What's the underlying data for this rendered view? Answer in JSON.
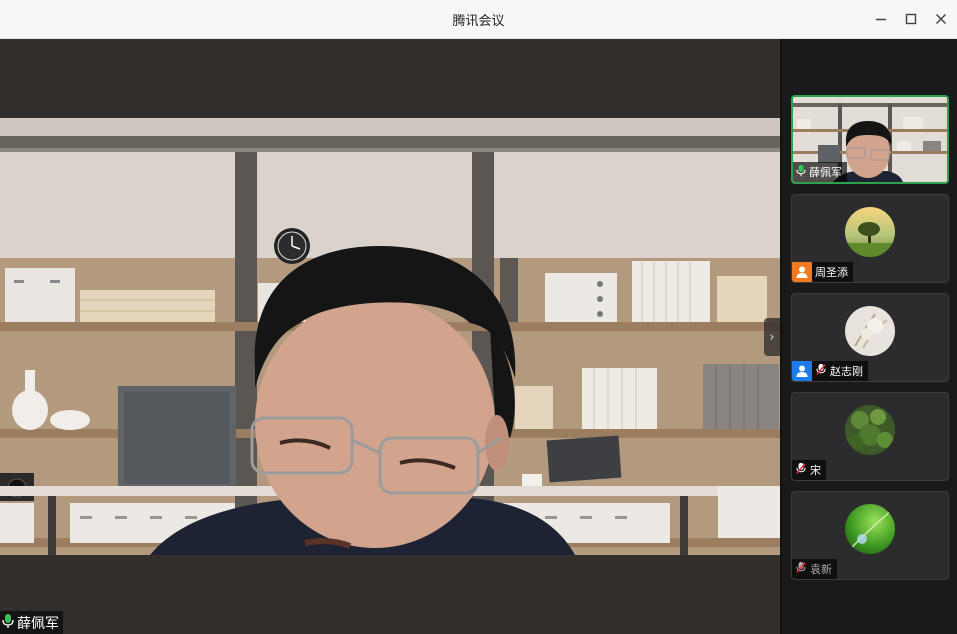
{
  "window": {
    "title": "腾讯会议",
    "minimize_icon": "minimize-icon",
    "maximize_icon": "maximize-icon",
    "close_icon": "close-icon"
  },
  "main_video": {
    "speaker_name": "薛佩军",
    "mic_state": "unmuted",
    "next_icon": "chevron-right-icon"
  },
  "participants": [
    {
      "name": "薛佩军",
      "mic": "unmuted",
      "role": "",
      "active": true,
      "avatar": "video-feed"
    },
    {
      "name": "周圣添",
      "mic": "none",
      "role": "host",
      "role_color": "#f07a1d",
      "active": false,
      "avatar": "tree-landscape"
    },
    {
      "name": "赵志刚",
      "mic": "muted",
      "role": "cohost",
      "role_color": "#1e7ce8",
      "active": false,
      "avatar": "dried-flower"
    },
    {
      "name": "宋",
      "mic": "muted",
      "role": "",
      "active": false,
      "avatar": "green-foliage"
    },
    {
      "name": "袁新",
      "mic": "muted",
      "role": "",
      "active": false,
      "avatar": "green-leaf-drop"
    }
  ],
  "colors": {
    "accent_green": "#2fa14d",
    "host_orange": "#f07a1d",
    "cohost_blue": "#1e7ce8",
    "muted_red": "#e0343a"
  }
}
